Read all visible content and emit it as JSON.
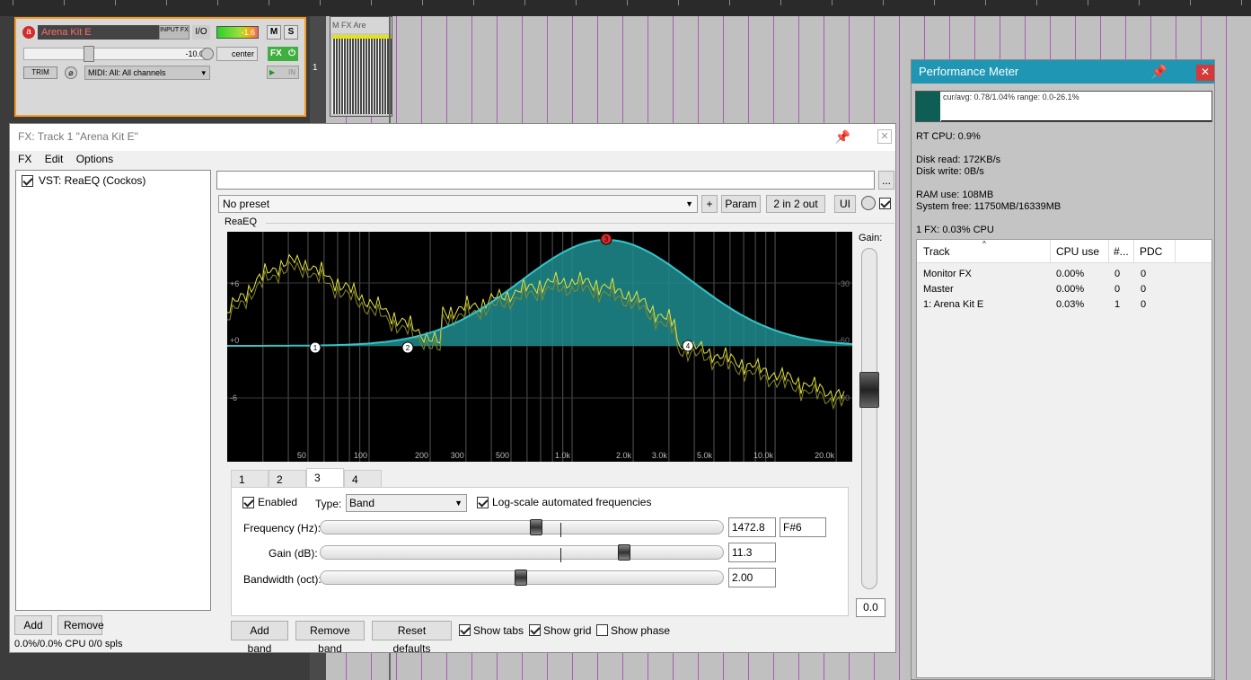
{
  "track": {
    "name": "Arena Kit E",
    "rec_icon": "a",
    "input_fx": "INPUT FX",
    "io_label": "I/O",
    "meter_value": "-1.6",
    "mute_label": "M",
    "solo_label": "S",
    "volume": "-10.0",
    "pan": "center",
    "fx_label": "FX",
    "trim_label": "TRIM",
    "midi_input": "MIDI: All: All channels",
    "input_label": "IN",
    "number": "1"
  },
  "item": {
    "header": "M  FX  Are"
  },
  "fx_window": {
    "title": "FX: Track 1 \"Arena Kit E\"",
    "menu": [
      "FX",
      "Edit",
      "Options"
    ],
    "fx_chain": [
      {
        "label": "VST: ReaEQ (Cockos)",
        "enabled": true
      }
    ],
    "add_label": "Add",
    "remove_label": "Remove",
    "cpu_status": "0.0%/0.0% CPU 0/0 spls",
    "plugin_name_value": "",
    "dots_label": "...",
    "preset": "No preset",
    "plus_label": "+",
    "param_label": "Param",
    "routing_label": "2 in 2 out",
    "ui_label": "UI",
    "plugin_title": "ReaEQ",
    "gain_label": "Gain:",
    "gain_value": "0.0",
    "graph": {
      "left_db_labels": [
        "+6",
        "+0",
        "-6"
      ],
      "right_db_labels": [
        "-30",
        "-60",
        "-90"
      ],
      "freq_labels": [
        "50",
        "100",
        "200",
        "300",
        "500",
        "1.0k",
        "2.0k",
        "3.0k",
        "5.0k",
        "10.0k",
        "20.0k"
      ],
      "band_points": [
        "1",
        "2",
        "3",
        "4"
      ],
      "curve_color": "#37c4c8",
      "spectrum_color": "#e6e63c",
      "selected_band_color": "#e02626"
    },
    "tabs": [
      "1",
      "2",
      "3",
      "4"
    ],
    "active_tab": "3",
    "band": {
      "enabled_label": "Enabled",
      "type_label": "Type:",
      "type_value": "Band",
      "logscale_label": "Log-scale automated frequencies",
      "frequency_label": "Frequency (Hz):",
      "frequency_value": "1472.8",
      "note_value": "F#6",
      "gain_label": "Gain (dB):",
      "gain_value": "11.3",
      "bandwidth_label": "Bandwidth (oct):",
      "bandwidth_value": "2.00"
    },
    "add_band_label": "Add band",
    "remove_band_label": "Remove band",
    "reset_defaults_label": "Reset defaults",
    "show_tabs_label": "Show tabs",
    "show_grid_label": "Show grid",
    "show_phase_label": "Show phase"
  },
  "perf_meter": {
    "title": "Performance Meter",
    "graph_caption": "cur/avg: 0.78/1.04%  range: 0.0-26.1%",
    "rt_cpu": "RT CPU: 0.9%",
    "disk_read": "Disk read: 172KB/s",
    "disk_write": "Disk write: 0B/s",
    "ram_use": "RAM use: 108MB",
    "system_free": "System free: 11750MB/16339MB",
    "fx_summary": "1 FX: 0.03% CPU",
    "columns": [
      "Track",
      "CPU use",
      "#...",
      "PDC"
    ],
    "rows": [
      {
        "track": "Monitor FX",
        "cpu": "0.00%",
        "count": "0",
        "pdc": "0"
      },
      {
        "track": "Master",
        "cpu": "0.00%",
        "count": "0",
        "pdc": "0"
      },
      {
        "track": "1: Arena Kit E",
        "cpu": "0.03%",
        "count": "1",
        "pdc": "0"
      }
    ]
  }
}
